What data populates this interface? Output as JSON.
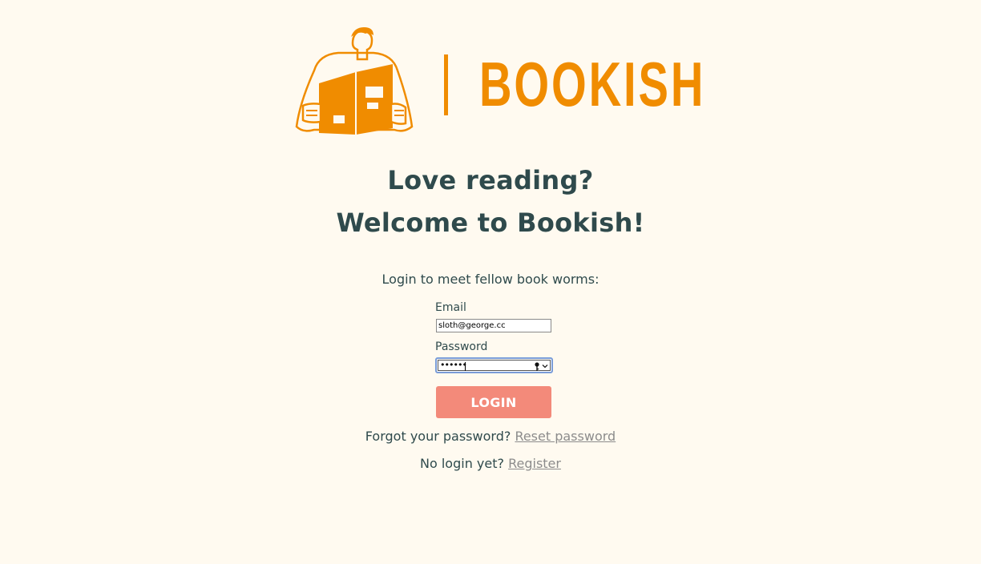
{
  "brand": {
    "name": "BOOKISH",
    "color": "#f08c00"
  },
  "headings": {
    "line1": "Love reading?",
    "line2": "Welcome to Bookish!"
  },
  "intro": "Login to meet fellow book worms:",
  "form": {
    "email_label": "Email",
    "email_value": "sloth@george.cc",
    "password_label": "Password",
    "password_masked": "••••••",
    "password_icons": [
      "key-icon",
      "chevron-down-icon"
    ]
  },
  "login_button": {
    "label": "LOGIN",
    "color": "#f38a7a"
  },
  "forgot": {
    "text": "Forgot your password?",
    "link": "Reset password"
  },
  "register": {
    "text": "No login yet?",
    "link": "Register"
  }
}
